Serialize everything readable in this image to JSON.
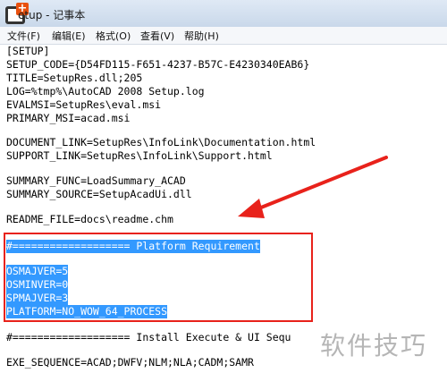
{
  "window": {
    "title": "etup - 记事本",
    "app_icon": "notepad-plus-icon"
  },
  "menu": {
    "items": [
      "文件(F)",
      "编辑(E)",
      "格式(O)",
      "查看(V)",
      "帮助(H)"
    ]
  },
  "editor": {
    "lines": [
      "[SETUP]",
      "SETUP_CODE={D54FD115-F651-4237-B57C-E4230340EAB6}",
      "TITLE=SetupRes.dll;205",
      "LOG=%tmp%\\AutoCAD 2008 Setup.log",
      "EVALMSI=SetupRes\\eval.msi",
      "PRIMARY_MSI=acad.msi",
      "",
      "DOCUMENT_LINK=SetupRes\\InfoLink\\Documentation.html",
      "SUPPORT_LINK=SetupRes\\InfoLink\\Support.html",
      "",
      "SUMMARY_FUNC=LoadSummary_ACAD",
      "SUMMARY_SOURCE=SetupAcadUi.dll",
      "",
      "README_FILE=docs\\readme.chm",
      "",
      "#=================== Platform Requirement",
      "",
      "OSMAJVER=5",
      "OSMINVER=0",
      "SPMAJVER=3",
      "PLATFORM=NO_WOW_64_PROCESS",
      "",
      "#=================== Install Execute & UI Sequ",
      "",
      "EXE_SEQUENCE=ACAD;DWFV;NLM;NLA;CADM;SAMR"
    ],
    "selected_lines": [
      15,
      16,
      17,
      18,
      19,
      20
    ]
  },
  "annotation": {
    "box_color": "#e8221b",
    "arrow_color": "#e8221b"
  },
  "watermark": {
    "text": "软件技巧"
  },
  "colors": {
    "selection": "#3399ff",
    "titlebar": "#dfe9f5"
  }
}
